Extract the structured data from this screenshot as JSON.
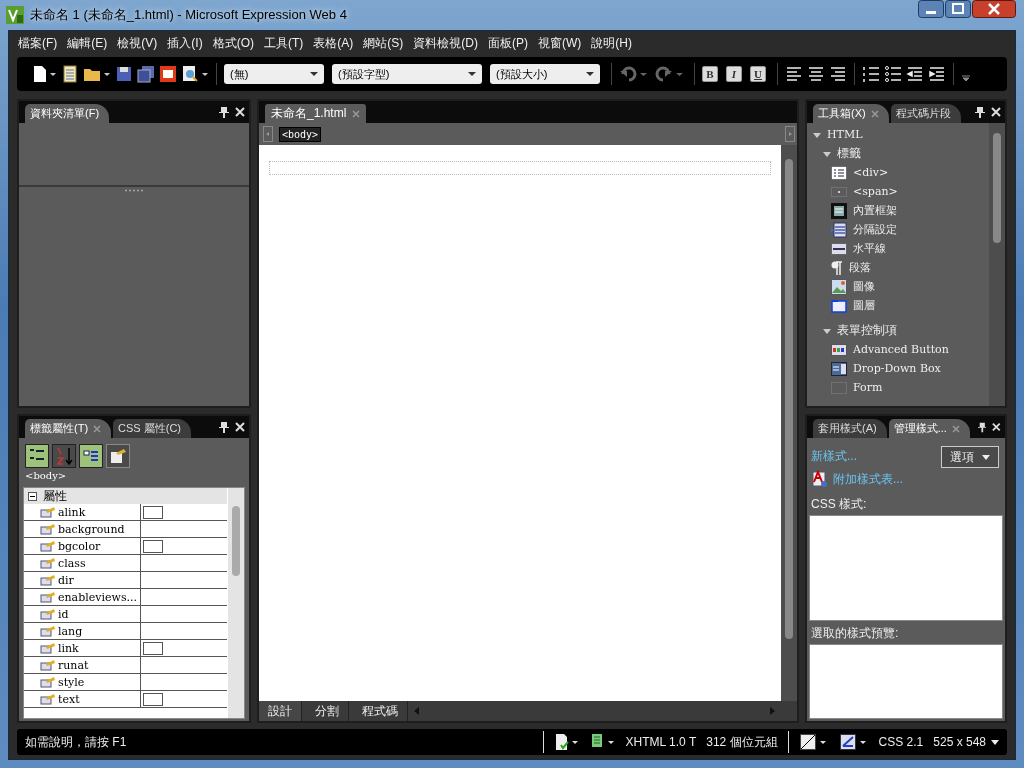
{
  "window": {
    "title": "未命名 1 (未命名_1.html) - Microsoft Expression Web 4"
  },
  "menu": [
    "檔案(F)",
    "編輯(E)",
    "檢視(V)",
    "插入(I)",
    "格式(O)",
    "工具(T)",
    "表格(A)",
    "網站(S)",
    "資料檢視(D)",
    "面板(P)",
    "視窗(W)",
    "說明(H)"
  ],
  "toolbar": {
    "dropdowns": [
      {
        "value": "(無)"
      },
      {
        "value": "(預設字型)"
      },
      {
        "value": "(預設大小)"
      }
    ],
    "format_buttons": [
      "B",
      "I",
      "U"
    ]
  },
  "folder_panel": {
    "tabs": [
      {
        "label": "資料夾清單(F)",
        "selected": true
      }
    ]
  },
  "tag_properties": {
    "tabs": [
      {
        "label": "標籤屬性(T)",
        "selected": true
      },
      {
        "label": "CSS 屬性(C)",
        "selected": false
      }
    ],
    "tag": "<body>",
    "group": {
      "label": "屬性",
      "expanded": true
    },
    "rows": [
      {
        "name": "alink",
        "kind": "color"
      },
      {
        "name": "background",
        "kind": "text"
      },
      {
        "name": "bgcolor",
        "kind": "color"
      },
      {
        "name": "class",
        "kind": "text"
      },
      {
        "name": "dir",
        "kind": "text"
      },
      {
        "name": "enableviews...",
        "kind": "text"
      },
      {
        "name": "id",
        "kind": "text"
      },
      {
        "name": "lang",
        "kind": "text"
      },
      {
        "name": "link",
        "kind": "color"
      },
      {
        "name": "runat",
        "kind": "text"
      },
      {
        "name": "style",
        "kind": "text"
      },
      {
        "name": "text",
        "kind": "color"
      }
    ]
  },
  "editor": {
    "tabs": [
      {
        "label": "未命名_1.html",
        "selected": true
      }
    ],
    "breadcrumb": "<body>",
    "view_tabs": [
      {
        "label": "設計",
        "selected": true
      },
      {
        "label": "分割",
        "selected": false
      },
      {
        "label": "程式碼",
        "selected": false
      }
    ]
  },
  "toolbox": {
    "tabs": [
      {
        "label": "工具箱(X)",
        "selected": true
      },
      {
        "label": "程式碼片段",
        "selected": false
      }
    ],
    "tree": [
      {
        "label": "HTML",
        "expanded": true,
        "children": [
          {
            "label": "標籤",
            "expanded": true,
            "children": [
              {
                "label": "<div>",
                "kind": "div"
              },
              {
                "label": "<span>",
                "kind": "span"
              },
              {
                "label": "內置框架",
                "kind": "iframe"
              },
              {
                "label": "分隔設定",
                "kind": "break"
              },
              {
                "label": "水平線",
                "kind": "rule"
              },
              {
                "label": "段落",
                "kind": "paragraph"
              },
              {
                "label": "圖像",
                "kind": "image"
              },
              {
                "label": "圖層",
                "kind": "layer"
              }
            ]
          },
          {
            "label": "表單控制項",
            "expanded": true,
            "children": [
              {
                "label": "Advanced Button",
                "kind": "button"
              },
              {
                "label": "Drop-Down Box",
                "kind": "dropdown"
              },
              {
                "label": "Form",
                "kind": "form"
              }
            ]
          }
        ]
      }
    ]
  },
  "styles": {
    "tabs": [
      {
        "label": "套用樣式(A)",
        "selected": false
      },
      {
        "label": "管理樣式...",
        "selected": true
      }
    ],
    "new_style": "新樣式...",
    "attach": "附加樣式表...",
    "options": "選項",
    "css_label": "CSS 樣式:",
    "preview_label": "選取的樣式預覽:"
  },
  "status_bar": {
    "help": "如需說明，請按 F1",
    "doctype": "XHTML 1.0 T",
    "size": "312 個位元組",
    "css": "CSS 2.1",
    "dimensions": "525 x 548"
  }
}
